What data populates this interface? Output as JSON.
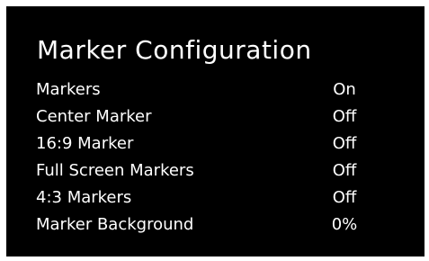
{
  "menu": {
    "title": "Marker Configuration",
    "items": [
      {
        "label": "Markers",
        "value": "On"
      },
      {
        "label": "Center Marker",
        "value": "Off"
      },
      {
        "label": "16:9 Marker",
        "value": "Off"
      },
      {
        "label": "Full Screen Markers",
        "value": "Off"
      },
      {
        "label": "4:3 Markers",
        "value": "Off"
      },
      {
        "label": "Marker Background",
        "value": "0%"
      }
    ]
  },
  "colors": {
    "background": "#000000",
    "text": "#ffffff",
    "frame": "#ffffff"
  }
}
